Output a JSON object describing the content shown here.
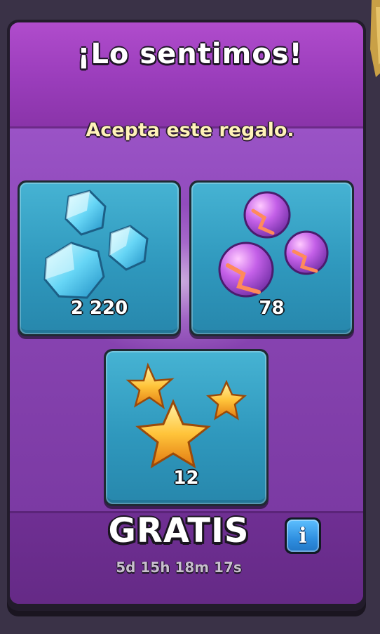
{
  "dialog": {
    "title": "¡Lo sentimos!",
    "subtitle": "Acepta este regalo."
  },
  "rewards": [
    {
      "icon": "gems-icon",
      "count": "2 220"
    },
    {
      "icon": "magic-items-icon",
      "count": "78"
    },
    {
      "icon": "star-fragments-icon",
      "count": "12"
    }
  ],
  "footer": {
    "price_label": "GRATIS",
    "timer": "5d 15h 18m 17s",
    "info_icon": "info-icon"
  },
  "colors": {
    "panel": "#8f3db4",
    "card": "#2f98bd",
    "subtitle": "#fff2b8",
    "info_button": "#2f8fe0"
  }
}
